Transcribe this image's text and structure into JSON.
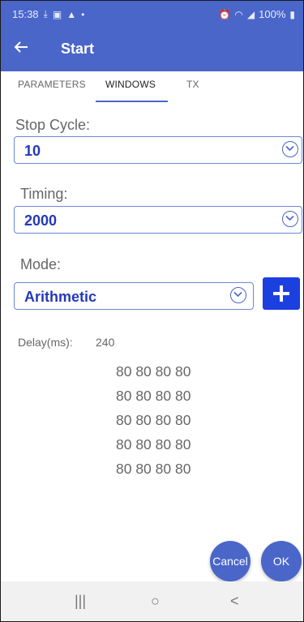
{
  "status_bar": {
    "time": "15:38",
    "battery": "100%",
    "left_icons": [
      "download-icon",
      "image-icon",
      "alert-icon",
      "dot-icon"
    ],
    "right_icons": [
      "alarm-icon",
      "wifi-icon",
      "signal-icon",
      "battery-icon"
    ]
  },
  "app_bar": {
    "title": "Start",
    "back_icon": "arrow-left-icon"
  },
  "tabs": [
    {
      "label": "PARAMETERS",
      "active": false
    },
    {
      "label": "WINDOWS",
      "active": true
    },
    {
      "label": "TX",
      "active": false
    }
  ],
  "form": {
    "stop_cycle": {
      "label": "Stop Cycle:",
      "value": "10"
    },
    "timing": {
      "label": "Timing:",
      "value": "2000"
    },
    "mode": {
      "label": "Mode:",
      "value": "Arithmetic"
    }
  },
  "delay": {
    "label": "Delay(ms):",
    "value": "240"
  },
  "values_grid": [
    "80 80 80 80",
    "80 80 80 80",
    "80 80 80 80",
    "80 80 80 80",
    "80 80 80 80"
  ],
  "actions": {
    "cancel": "Cancel",
    "ok": "OK"
  },
  "nav_bar": {
    "recents": "|||",
    "home": "○",
    "back": "<"
  },
  "colors": {
    "primary": "#4a66c9",
    "accent_blue": "#1c3fe0",
    "value_text": "#2438b8"
  }
}
